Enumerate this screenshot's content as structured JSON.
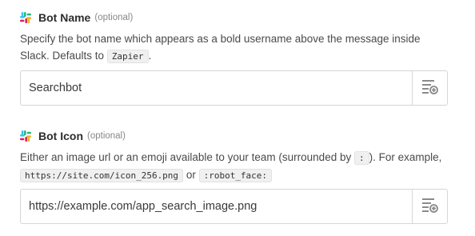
{
  "fields": [
    {
      "label": "Bot Name",
      "optional": "(optional)",
      "help_parts": [
        "Specify the bot name which appears as a bold username above the message inside Slack. Defaults to ",
        "Zapier",
        "."
      ],
      "value": "Searchbot"
    },
    {
      "label": "Bot Icon",
      "optional": "(optional)",
      "help_parts": [
        "Either an image url or an emoji available to your team (surrounded by ",
        ":",
        "). For example, ",
        "https://site.com/icon_256.png",
        " or ",
        ":robot_face:"
      ],
      "value": "https://example.com/app_search_image.png"
    }
  ],
  "icons": {
    "label_icon": "slack-logo-icon",
    "insert_icon": "insert-data-icon"
  },
  "colors": {
    "slack_blue": "#36C5F0",
    "slack_green": "#2EB67D",
    "slack_yellow": "#ECB22E",
    "slack_red": "#E01E5A",
    "border": "#d6d6d6",
    "icon_gray": "#8a8a8a"
  }
}
